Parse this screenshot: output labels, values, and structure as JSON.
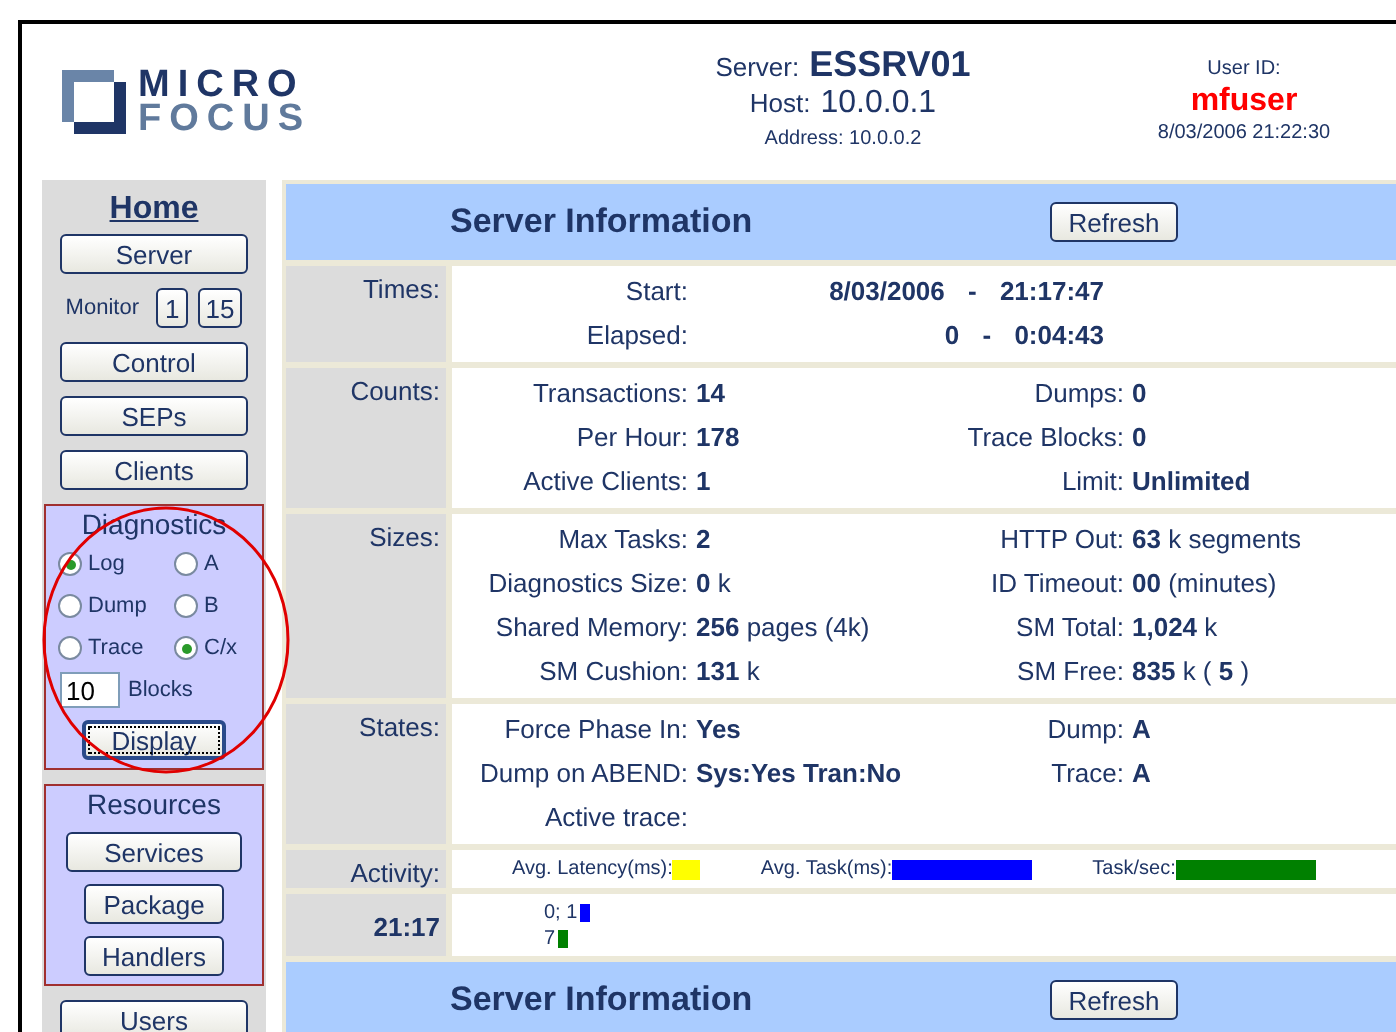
{
  "header": {
    "logo": {
      "top": "MICRO",
      "bottom": "FOCUS"
    },
    "server": {
      "label": "Server:",
      "value": "ESSRV01"
    },
    "host": {
      "label": "Host:",
      "value": "10.0.0.1"
    },
    "address": "Address: 10.0.0.2",
    "user": {
      "label": "User ID:",
      "name": "mfuser",
      "datetime": "8/03/2006 21:22:30"
    }
  },
  "sidebar": {
    "home": "Home",
    "buttons_top": [
      "Server"
    ],
    "monitor": {
      "label": "Monitor",
      "buttons": [
        "1",
        "15"
      ]
    },
    "buttons_mid": [
      "Control",
      "SEPs",
      "Clients"
    ],
    "diagnostics": {
      "title": "Diagnostics",
      "options": [
        {
          "label": "Log",
          "selected": true
        },
        {
          "label": "A",
          "selected": false
        },
        {
          "label": "Dump",
          "selected": false
        },
        {
          "label": "B",
          "selected": false
        },
        {
          "label": "Trace",
          "selected": false
        },
        {
          "label": "C/x",
          "selected": true
        }
      ],
      "blocks": {
        "value": "10",
        "label": "Blocks"
      },
      "button": "Display"
    },
    "resources": {
      "title": "Resources",
      "buttons": [
        "Services",
        "Package",
        "Handlers"
      ]
    },
    "buttons_bottom": [
      "Users"
    ]
  },
  "main": {
    "title": "Server Information",
    "refresh": "Refresh",
    "sections": [
      {
        "label": "Times:",
        "kind": "times",
        "rows": [
          {
            "label": "Start:",
            "value": "8/03/2006 - 21:17:47"
          },
          {
            "label": "Elapsed:",
            "value": "0 - 0:04:43"
          }
        ]
      },
      {
        "label": "Counts:",
        "kind": "pairs",
        "rows": [
          [
            {
              "label": "Transactions:",
              "value": "14"
            },
            {
              "label": "Dumps:",
              "value": "0"
            }
          ],
          [
            {
              "label": "Per Hour:",
              "value": "178"
            },
            {
              "label": "Trace Blocks:",
              "value": "0"
            }
          ],
          [
            {
              "label": "Active Clients:",
              "value": "1"
            },
            {
              "label": "Limit:",
              "value": "Unlimited"
            }
          ]
        ]
      },
      {
        "label": "Sizes:",
        "kind": "pairs",
        "rows": [
          [
            {
              "label": "Max Tasks:",
              "value": "2"
            },
            {
              "label": "HTTP Out:",
              "rich": "**63** k segments"
            }
          ],
          [
            {
              "label": "Diagnostics Size:",
              "rich": "**0** k"
            },
            {
              "label": "ID Timeout:",
              "rich": "**00** (minutes)"
            }
          ],
          [
            {
              "label": "Shared Memory:",
              "rich": "**256** pages (4k)"
            },
            {
              "label": "SM Total:",
              "rich": "**1,024** k"
            }
          ],
          [
            {
              "label": "SM Cushion:",
              "rich": "**131** k"
            },
            {
              "label": "SM Free:",
              "rich": "**835** k ( **5** )"
            }
          ]
        ]
      },
      {
        "label": "States:",
        "kind": "pairs",
        "rows": [
          [
            {
              "label": "Force Phase In:",
              "value": "Yes"
            },
            {
              "label": "Dump:",
              "value": "A"
            }
          ],
          [
            {
              "label": "Dump on ABEND:",
              "value": "Sys:Yes Tran:No"
            },
            {
              "label": "Trace:",
              "value": "A"
            }
          ],
          [
            {
              "label": "Active trace:"
            }
          ]
        ]
      },
      {
        "label": "Activity:",
        "kind": "legend",
        "items": [
          {
            "label": "Avg. Latency(ms):",
            "color": "#ffff00"
          },
          {
            "label": "Avg. Task(ms):",
            "color": "#0000ff"
          },
          {
            "label": "Task/sec:",
            "color": "#008000"
          }
        ]
      },
      {
        "label": "21:17",
        "kind": "sample",
        "items": [
          {
            "label": "0; 1",
            "color": "#0000ff"
          },
          {
            "label": "7",
            "color": "#008000"
          }
        ]
      }
    ],
    "footer": {
      "title": "Server Information",
      "refresh": "Refresh"
    }
  }
}
